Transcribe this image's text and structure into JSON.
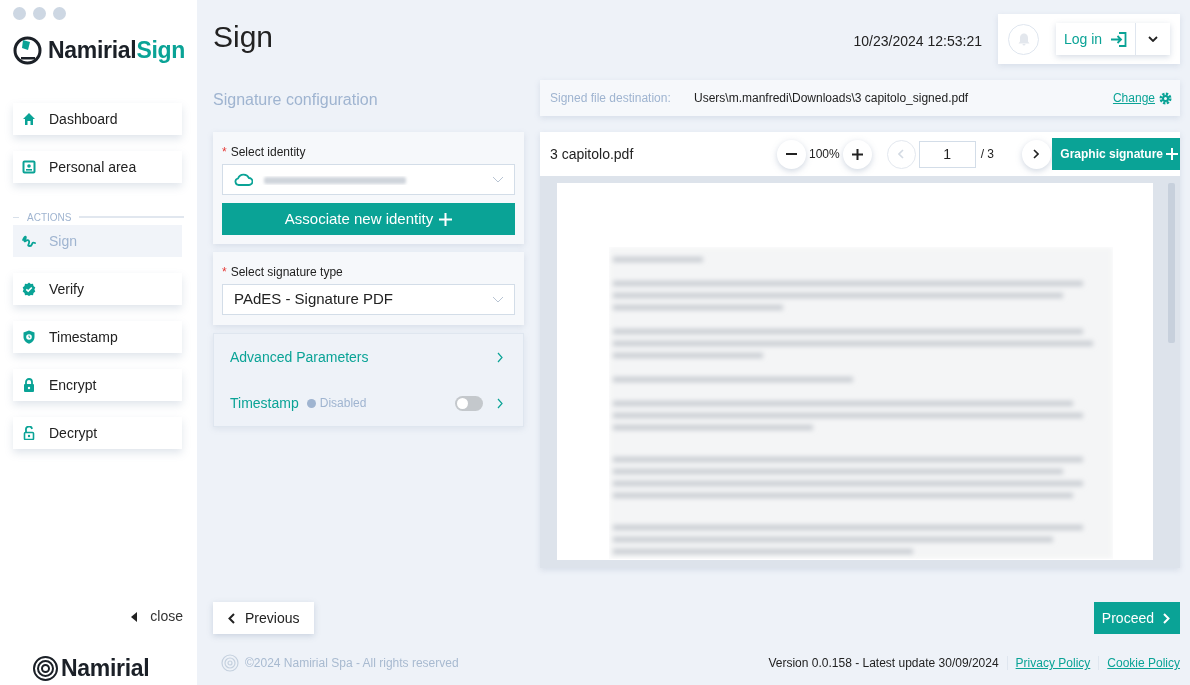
{
  "brand": {
    "name": "Namirial",
    "suffix": "Sign"
  },
  "sidebar": {
    "items": [
      {
        "label": "Dashboard",
        "selected": false
      },
      {
        "label": "Personal area",
        "selected": false
      }
    ],
    "section": {
      "title": "ACTIONS",
      "items": [
        {
          "label": "Sign",
          "selected": true
        },
        {
          "label": "Verify",
          "selected": false
        },
        {
          "label": "Timestamp",
          "selected": false
        },
        {
          "label": "Encrypt",
          "selected": false
        },
        {
          "label": "Decrypt",
          "selected": false
        }
      ]
    },
    "close": "close",
    "footer_logo": "Namirial"
  },
  "header": {
    "title": "Sign",
    "datetime": "10/23/2024 12:53:21",
    "login": "Log in"
  },
  "config": {
    "heading": "Signature configuration",
    "identity": {
      "required_mark": "*",
      "label": "Select identity"
    },
    "associate_button": "Associate new identity",
    "signature_type": {
      "required_mark": "*",
      "label": "Select signature type",
      "value": "PAdES - Signature PDF"
    },
    "options": [
      {
        "kind": "link",
        "label": "Advanced Parameters"
      },
      {
        "kind": "toggle",
        "label": "Timestamp",
        "status": "Disabled",
        "on": false
      }
    ]
  },
  "destination": {
    "label": "Signed file destination:",
    "path": "Users\\m.manfredi\\Downloads\\3 capitolo_signed.pdf",
    "change": "Change"
  },
  "viewer": {
    "file": "3 capitolo.pdf",
    "zoom": "100%",
    "page": "1",
    "total": "/ 3",
    "prev_disabled": true,
    "graphic_signature": "Graphic signature"
  },
  "nav": {
    "previous": "Previous",
    "proceed": "Proceed"
  },
  "footer": {
    "copyright": "©2024 Namirial Spa - All rights reserved",
    "version": "Version 0.0.158 - Latest update 30/09/2024",
    "links": [
      "Privacy Policy",
      "Cookie Policy"
    ]
  }
}
